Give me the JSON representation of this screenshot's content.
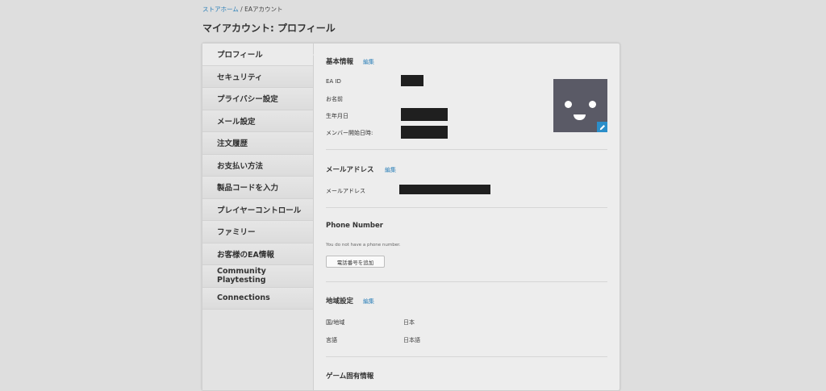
{
  "breadcrumb": {
    "home": "ストアホーム",
    "sep": " / ",
    "current": "EAアカウント"
  },
  "page_title": "マイアカウント: プロフィール",
  "sidebar": {
    "items": [
      {
        "label": "プロフィール"
      },
      {
        "label": "セキュリティ"
      },
      {
        "label": "プライバシー設定"
      },
      {
        "label": "メール設定"
      },
      {
        "label": "注文履歴"
      },
      {
        "label": "お支払い方法"
      },
      {
        "label": "製品コードを入力"
      },
      {
        "label": "プレイヤーコントロール"
      },
      {
        "label": "ファミリー"
      },
      {
        "label": "お客様のEA情報"
      },
      {
        "label": "Community Playtesting"
      },
      {
        "label": "Connections"
      }
    ]
  },
  "basic": {
    "title": "基本情報",
    "edit": "編集",
    "ea_id_label": "EA ID",
    "name_label": "お名前",
    "dob_label": "生年月日",
    "member_since_label": "メンバー開始日時:"
  },
  "email": {
    "title": "メールアドレス",
    "edit": "編集",
    "label": "メールアドレス"
  },
  "phone": {
    "title": "Phone Number",
    "note": "You do not have a phone number.",
    "add_button": "電話番号を追加"
  },
  "region": {
    "title": "地域設定",
    "edit": "編集",
    "country_label": "国/地域",
    "country_value": "日本",
    "language_label": "言語",
    "language_value": "日本語"
  },
  "game": {
    "title": "ゲーム固有情報"
  },
  "colors": {
    "accent": "#2b7fb8",
    "avatar_bg": "#5a5a66",
    "redact": "#1f1f1f"
  }
}
